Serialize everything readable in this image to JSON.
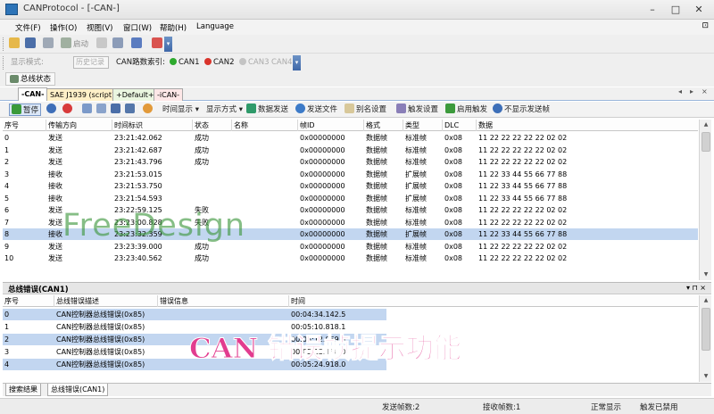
{
  "window": {
    "title": "CANProtocol - [-CAN-]",
    "min": "–",
    "max": "□",
    "close": "✕"
  },
  "menu": [
    "文件(F)",
    "操作(O)",
    "视图(V)",
    "窗口(W)",
    "帮助(H)",
    "Language"
  ],
  "toolbar1": {
    "start_label": "启动",
    "overflow": "▾"
  },
  "toolbar2": {
    "display_mode_label": "显示模式:",
    "display_mode_value": "历史记录",
    "can_index_label": "CAN路数索引:",
    "channels": [
      {
        "label": "CAN1",
        "color": "#2eaa2e"
      },
      {
        "label": "CAN2",
        "color": "#d9342b"
      },
      {
        "label": "CAN3",
        "color": "#b8b8b8"
      },
      {
        "label": "CAN4",
        "color": "#b8b8b8"
      }
    ]
  },
  "busstatus": {
    "label": "总线状态"
  },
  "tabs": [
    "-CAN-",
    "SAE J1939 (script)",
    "+Default+",
    "-iCAN-"
  ],
  "tab_nav": [
    "◂",
    "▸",
    "×"
  ],
  "msg_toolbar": {
    "pause": "暂停",
    "time_display": "时间显示",
    "display_mode": "显示方式",
    "send_data": "数据发送",
    "send_file": "发送文件",
    "alias": "别名设置",
    "trigger_settings": "触发设置",
    "enable_trigger": "启用触发",
    "hide_send": "不显示发送帧"
  },
  "msg_table": {
    "columns": [
      "序号",
      "传输方向",
      "时间标识",
      "状态",
      "名称",
      "帧ID",
      "格式",
      "类型",
      "DLC",
      "数据"
    ],
    "rows": [
      [
        "0",
        "发送",
        "23:21:42.062",
        "成功",
        "",
        "0x00000000",
        "数据帧",
        "标准帧",
        "0x08",
        "11 22 22 22 22 22 02 02"
      ],
      [
        "1",
        "发送",
        "23:21:42.687",
        "成功",
        "",
        "0x00000000",
        "数据帧",
        "标准帧",
        "0x08",
        "11 22 22 22 22 22 02 02"
      ],
      [
        "2",
        "发送",
        "23:21:43.796",
        "成功",
        "",
        "0x00000000",
        "数据帧",
        "标准帧",
        "0x08",
        "11 22 22 22 22 22 02 02"
      ],
      [
        "3",
        "接收",
        "23:21:53.015",
        "",
        "",
        "0x00000000",
        "数据帧",
        "扩展帧",
        "0x08",
        "11 22 33 44 55 66 77 88"
      ],
      [
        "4",
        "接收",
        "23:21:53.750",
        "",
        "",
        "0x00000000",
        "数据帧",
        "扩展帧",
        "0x08",
        "11 22 33 44 55 66 77 88"
      ],
      [
        "5",
        "接收",
        "23:21:54.593",
        "",
        "",
        "0x00000000",
        "数据帧",
        "扩展帧",
        "0x08",
        "11 22 33 44 55 66 77 88"
      ],
      [
        "6",
        "发送",
        "23:22:59.125",
        "失败",
        "",
        "0x00000000",
        "数据帧",
        "标准帧",
        "0x08",
        "11 22 22 22 22 22 02 02"
      ],
      [
        "7",
        "发送",
        "23:23:00.828",
        "失败",
        "",
        "0x00000000",
        "数据帧",
        "标准帧",
        "0x08",
        "11 22 22 22 22 22 02 02"
      ],
      [
        "8",
        "接收",
        "23:23:32.359",
        "",
        "",
        "0x00000000",
        "数据帧",
        "扩展帧",
        "0x08",
        "11 22 33 44 55 66 77 88"
      ],
      [
        "9",
        "发送",
        "23:23:39.000",
        "成功",
        "",
        "0x00000000",
        "数据帧",
        "标准帧",
        "0x08",
        "11 22 22 22 22 22 02 02"
      ],
      [
        "10",
        "发送",
        "23:23:40.562",
        "成功",
        "",
        "0x00000000",
        "数据帧",
        "标准帧",
        "0x08",
        "11 22 22 22 22 22 02 02"
      ]
    ],
    "selected_row": 8
  },
  "err_panel": {
    "title": "总线错误(CAN1)",
    "pin": "▾ ⊓ ×",
    "columns": [
      "序号",
      "总线错误描述",
      "错误信息",
      "时间"
    ],
    "rows": [
      [
        "0",
        "CAN控制器总线错误(0x85)",
        "",
        "00:04:34.142.5"
      ],
      [
        "1",
        "CAN控制器总线错误(0x85)",
        "",
        "00:05:10.818.1"
      ],
      [
        "2",
        "CAN控制器总线错误(0x85)",
        "",
        "00:05:12.069.9"
      ],
      [
        "3",
        "CAN控制器总线错误(0x85)",
        "",
        "00:05:13.160.0"
      ],
      [
        "4",
        "CAN控制器总线错误(0x85)",
        "",
        "00:05:24.918.0"
      ]
    ]
  },
  "bottom_tabs": [
    "搜索结果",
    "总线错误(CAN1)"
  ],
  "status": {
    "sent": "发送帧数:2",
    "recv": "接收帧数:1",
    "display": "正常显示",
    "trigger": "触发已禁用"
  },
  "watermark": "FreeDesign",
  "caption": "CAN 错误帧提示功能"
}
